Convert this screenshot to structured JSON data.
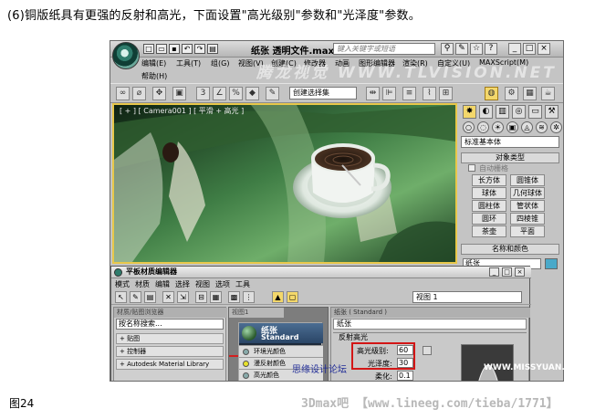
{
  "caption": "(6)铜版纸具有更强的反射和高光，下面设置\"高光级别\"参数和\"光泽度\"参数。",
  "figure_label": "图24",
  "watermark_bottom": "3Dmax吧 【www.lineeg.com/tieba/1771】",
  "app": {
    "title": "纸张 透明文件.max",
    "search_placeholder": "键入关键字或短语",
    "menus": [
      "编辑(E)",
      "工具(T)",
      "组(G)",
      "视图(V)",
      "创建(C)",
      "修改器",
      "动画",
      "图形编辑器",
      "渲染(R)",
      "自定义(U)",
      "MAXScript(M)"
    ],
    "menu_help": "帮助(H)",
    "watermark_mid": "腾龙视觉 WWW.TLVISION.NET",
    "selection_set": "创建选择集",
    "viewport_label": "[ + ] [ Camera001 ] [ 平滑 + 高光 ]",
    "cmd_dropdown": "标准基本体",
    "object_type_header": "对象类型",
    "autogrid_label": "自动栅格",
    "object_buttons": [
      "长方体",
      "圆锥体",
      "球体",
      "几何球体",
      "圆柱体",
      "管状体",
      "圆环",
      "四棱锥",
      "茶壶",
      "平面"
    ],
    "name_color_header": "名称和颜色",
    "name_value": "纸张",
    "colors": {
      "accent_yellow": "#f3d76b",
      "highlight_red": "#d31616",
      "swatch": "#4aa9c9"
    }
  },
  "mated": {
    "title": "平板材质编辑器",
    "menus": [
      "模式",
      "材质",
      "编辑",
      "选择",
      "视图",
      "选项",
      "工具"
    ],
    "browser_header": "材质/贴图浏览器",
    "browser_search": "按名称搜索...",
    "library_rows": [
      "+ 贴图",
      "+ 控制器",
      "+ Autodesk Material Library"
    ],
    "graph_tab": "视图1",
    "node_name": "纸张",
    "node_type": "Standard",
    "slots": [
      "环境光颜色",
      "漫反射颜色",
      "高光颜色"
    ],
    "view_select": "视图 1",
    "props_header": "纸张 ( Standard )",
    "props_name": "纸张",
    "specular_header": "反射高光",
    "spec_level_label": "高光级别:",
    "spec_level_value": "60",
    "gloss_label": "光泽度:",
    "gloss_value": "30",
    "soften_label": "柔化:",
    "soften_value": "0.1"
  },
  "forum_watermark": "思缘设计论坛",
  "missyuan_watermark": "WWW.MISSYUAN.COM"
}
